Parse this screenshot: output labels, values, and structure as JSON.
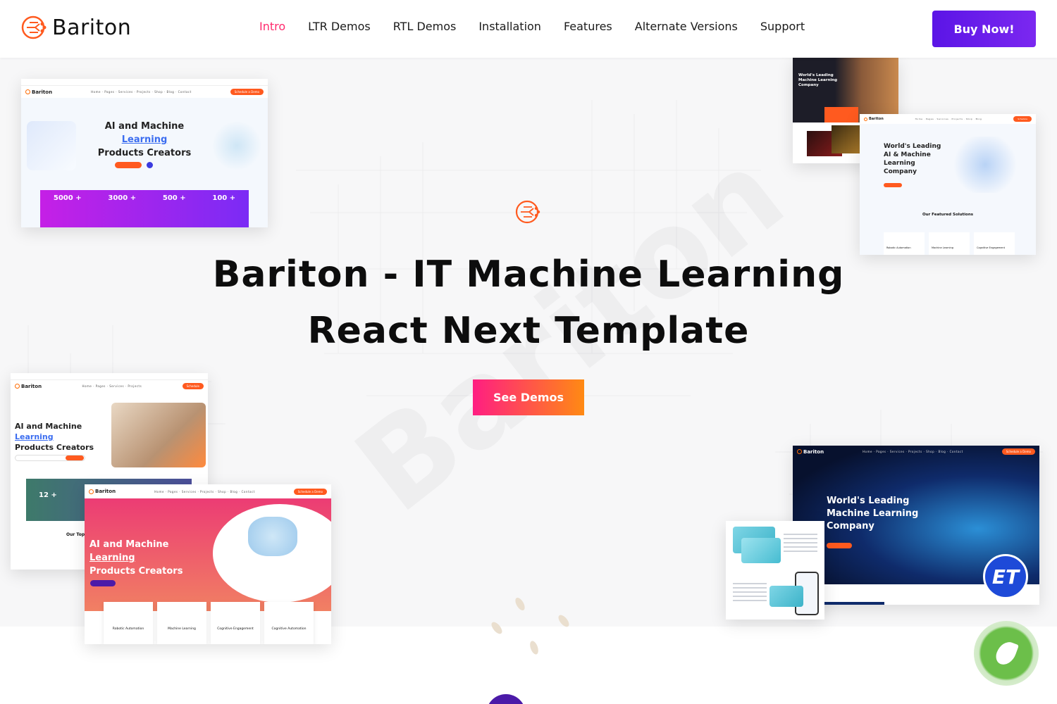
{
  "header": {
    "logo_text": "Bariton",
    "nav": [
      {
        "label": "Intro",
        "active": true
      },
      {
        "label": "LTR Demos",
        "active": false
      },
      {
        "label": "RTL Demos",
        "active": false
      },
      {
        "label": "Installation",
        "active": false
      },
      {
        "label": "Features",
        "active": false
      },
      {
        "label": "Alternate Versions",
        "active": false
      },
      {
        "label": "Support",
        "active": false
      }
    ],
    "buy_label": "Buy Now!"
  },
  "hero": {
    "title_line1": "Bariton - IT Machine Learning",
    "title_line2": "React Next Template",
    "cta_label": "See Demos"
  },
  "watermark": "Bariton",
  "previews": {
    "demo1": {
      "heading_a": "AI and Machine ",
      "heading_hl": "Learning",
      "heading_b": "Products Creators",
      "stats": [
        {
          "value": "5000 +"
        },
        {
          "value": "3000 +"
        },
        {
          "value": "500 +"
        },
        {
          "value": "100 +"
        }
      ]
    },
    "demo2": {
      "heading_a": "AI and Machine ",
      "heading_hl": "Learning",
      "heading_b": "Products Creators",
      "stat": "12 +",
      "section": "Our Top"
    },
    "demo3": {
      "heading_a": "AI and Machine ",
      "heading_hl": "Learning",
      "heading_b": "Products Creators",
      "features": [
        "Robotic Automation",
        "Machine Learning",
        "Cognitive Engagement",
        "Cognitive Automation"
      ]
    },
    "demo4": {
      "heading": "World's Leading Machine Learning Company"
    },
    "demo5": {
      "heading": "World's Leading AI & Machine Learning Company",
      "section": "Our Featured Solutions",
      "features": [
        "Robotic Automation",
        "Machine Learning",
        "Cognitive Engagement"
      ]
    },
    "demo6": {
      "heading": "World's Leading Machine Learning Company"
    }
  },
  "badges": {
    "et": "ET"
  },
  "colors": {
    "accent_pink": "#ff2a6d",
    "buy_purple": "#5b15e6",
    "cta_start": "#ff1e82",
    "cta_end": "#ff8a13",
    "logo_orange": "#ff5a1f"
  }
}
